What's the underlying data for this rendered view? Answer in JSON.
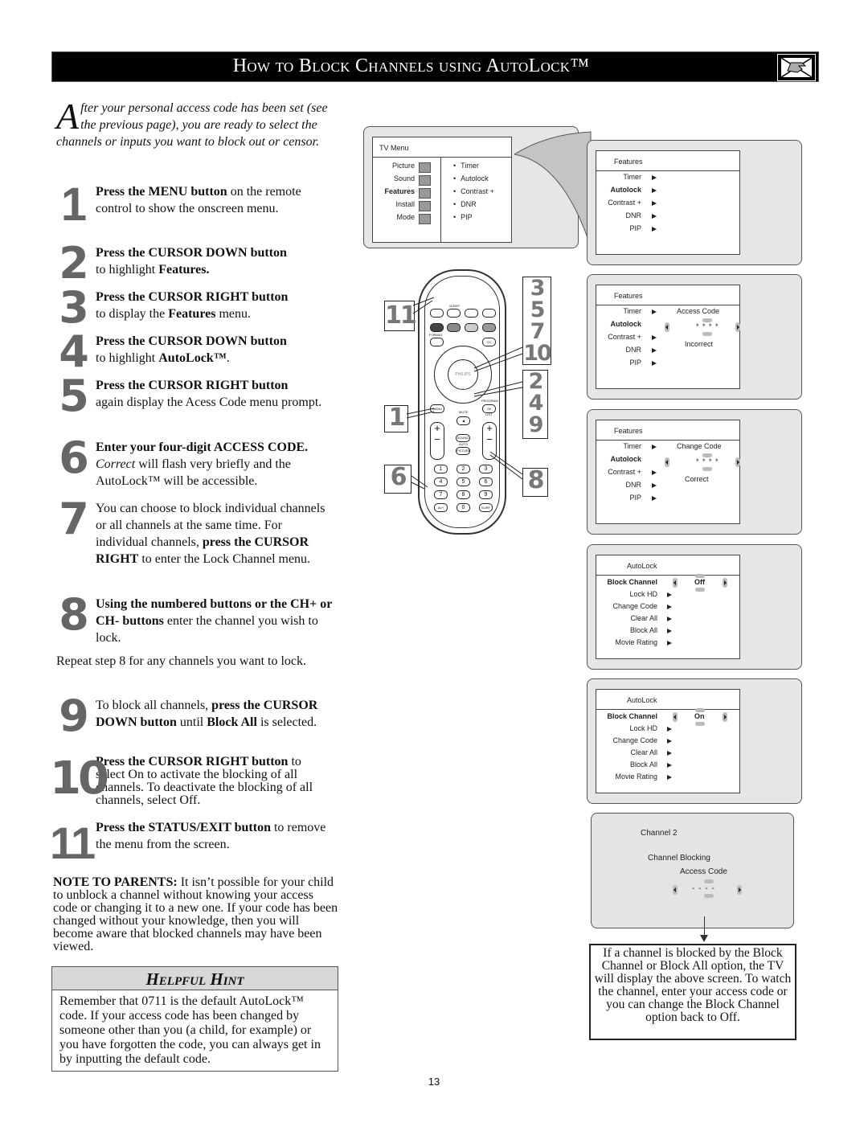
{
  "header": {
    "title": "How to Block Channels using AutoLock™",
    "icon": "hand-pointing-icon"
  },
  "intro": {
    "drop_cap": "A",
    "text": "fter your personal access code has been set (see the previous page), you are ready to select the channels or inputs you want to block out or censor."
  },
  "steps": [
    {
      "num": "1",
      "bold": "Press the MENU button",
      "rest": " on the remote control to show the onscreen menu."
    },
    {
      "num": "2",
      "bold": "Press the CURSOR DOWN button",
      "rest": " to highlight ",
      "bold2": "Features."
    },
    {
      "num": "3",
      "bold": "Press the CURSOR RIGHT button",
      "rest": " to display the ",
      "bold2": "Features",
      "rest2": " menu."
    },
    {
      "num": "4",
      "bold": "Press the CURSOR DOWN button",
      "rest": " to highlight ",
      "bold2": "AutoLock™",
      "rest2": "."
    },
    {
      "num": "5",
      "bold": "Press the CURSOR RIGHT button",
      "rest": " again display the Acess Code menu prompt."
    },
    {
      "num": "6",
      "bold": "Enter your four-digit ACCESS CODE.",
      "italic": " Correct",
      "rest": " will flash very briefly and the AutoLock™ will be accessible."
    },
    {
      "num": "7",
      "pre": "You can choose to block individual channels or all channels at the same time. For individual channels, ",
      "bold": "press the CURSOR RIGHT",
      "rest": " to enter the Lock Channel menu."
    },
    {
      "num": "8",
      "bold": "Using the numbered buttons or the CH+ or CH- buttons",
      "rest": " enter the channel you wish to lock."
    },
    {
      "num": "9",
      "pre": "To block all channels, ",
      "bold": "press the CURSOR DOWN button",
      "rest": " until ",
      "bold2": "Block All",
      "rest2": " is selected."
    },
    {
      "num": "10",
      "bold": "Press the CURSOR RIGHT button",
      "rest": " to select On to activate the blocking of all channels. To deactivate the blocking of all channels, select Off."
    },
    {
      "num": "11",
      "bold": "Press the STATUS/EXIT button",
      "rest": " to remove the menu from the screen."
    }
  ],
  "repeat_text": "Repeat step 8 for any channels you want to lock.",
  "note": {
    "label": "NOTE TO PARENTS:",
    "text": "  It isn’t possible for your child to unblock a channel without knowing your access code or changing it to a new one. If your code has been changed without your knowledge, then you will become aware that blocked channels may have been viewed."
  },
  "hint": {
    "title": "Helpful Hint",
    "text": "Remember that 0711 is the default AutoLock™ code.  If your access code has been changed by someone other than you (a child, for example) or you have forgotten the code, you can always get in by inputting the default code."
  },
  "tv_menu": {
    "title": "TV Menu",
    "left": [
      "Picture",
      "Sound",
      "Features",
      "Install",
      "Mode"
    ],
    "selected": "Features",
    "right": [
      "Timer",
      "Autolock",
      "Contrast +",
      "DNR",
      "PIP"
    ]
  },
  "features_screens": [
    {
      "title": "Features",
      "items": [
        "Timer",
        "Autolock",
        "Contrast +",
        "DNR",
        "PIP"
      ],
      "selected": "Autolock"
    },
    {
      "title": "Features",
      "items": [
        "Timer",
        "Autolock",
        "Contrast +",
        "DNR",
        "PIP"
      ],
      "selected": "Autolock",
      "prompt": "Access Code",
      "code": "* * * *",
      "status": "Incorrect"
    },
    {
      "title": "Features",
      "items": [
        "Timer",
        "Autolock",
        "Contrast +",
        "DNR",
        "PIP"
      ],
      "selected": "Autolock",
      "prompt": "Change Code",
      "code": "* * * *",
      "status": "Correct"
    }
  ],
  "autolock_screens": [
    {
      "title": "AutoLock",
      "items": [
        "Block Channel",
        "Lock HD",
        "Change Code",
        "Clear All",
        "Block All",
        "Movie Rating"
      ],
      "selected": "Block Channel",
      "value": "Off"
    },
    {
      "title": "AutoLock",
      "items": [
        "Block Channel",
        "Lock HD",
        "Change Code",
        "Clear All",
        "Block All",
        "Movie Rating"
      ],
      "selected": "Block Channel",
      "value": "On"
    }
  ],
  "blocked_screen": {
    "channel": "Channel 2",
    "heading": "Channel Blocking",
    "prompt": "Access Code",
    "code": "- - - -"
  },
  "caption": "If a channel is blocked by the Block Channel or Block All option, the TV will display the above screen. To watch the channel, enter your access code or you can change the Block Channel option back to Off.",
  "remote": {
    "brand": "PHILIPS",
    "labels": {
      "sleep": "SLEEP",
      "format": "FORMAT",
      "menu": "MENU",
      "program": "PROGRAM",
      "ok": "OK",
      "mute": "MUTE",
      "list": "LIST",
      "sound": "SOUND",
      "auto": "AUTO",
      "picture": "PICTURE",
      "cc": "CC",
      "ch": "CH",
      "av": "AV+",
      "surf": "SURF"
    },
    "keypad": [
      "1",
      "2",
      "3",
      "4",
      "5",
      "6",
      "7",
      "8",
      "9",
      "0"
    ],
    "callouts": {
      "top_left": "11",
      "right_top": "3\n5\n7\n10",
      "left_mid": "1",
      "right_mid": "2\n4\n9",
      "left_bottom": "6",
      "right_bottom": "8"
    }
  },
  "page_number": "13"
}
